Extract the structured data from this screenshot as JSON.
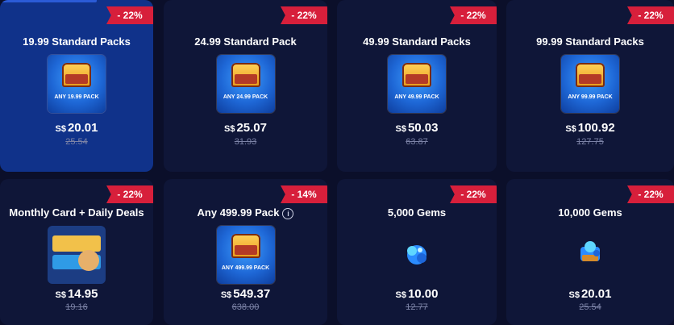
{
  "cards": [
    {
      "discount": "- 22%",
      "title": "19.99 Standard Packs",
      "pack_label": "ANY 19.99 PACK",
      "currency": "S$",
      "price": "20.01",
      "old": "25.54"
    },
    {
      "discount": "- 22%",
      "title": "24.99 Standard Pack",
      "pack_label": "ANY 24.99 PACK",
      "currency": "S$",
      "price": "25.07",
      "old": "31.93"
    },
    {
      "discount": "- 22%",
      "title": "49.99 Standard Packs",
      "pack_label": "ANY 49.99 PACK",
      "currency": "S$",
      "price": "50.03",
      "old": "63.87"
    },
    {
      "discount": "- 22%",
      "title": "99.99 Standard Packs",
      "pack_label": "ANY 99.99 PACK",
      "currency": "S$",
      "price": "100.92",
      "old": "127.75"
    },
    {
      "discount": "- 22%",
      "title": "Monthly Card + Daily Deals",
      "currency": "S$",
      "price": "14.95",
      "old": "19.16"
    },
    {
      "discount": "- 14%",
      "title": "Any 499.99 Pack",
      "pack_label": "ANY 499.99 PACK",
      "currency": "S$",
      "price": "549.37",
      "old": "638.00"
    },
    {
      "discount": "- 22%",
      "title": "5,000 Gems",
      "currency": "S$",
      "price": "10.00",
      "old": "12.77"
    },
    {
      "discount": "- 22%",
      "title": "10,000 Gems",
      "currency": "S$",
      "price": "20.01",
      "old": "25.54"
    }
  ],
  "colors": {
    "accent": "#d71f3b",
    "selected_card": "#10328a",
    "card_bg": "#0f1638",
    "page_bg": "#0b0f2a"
  }
}
